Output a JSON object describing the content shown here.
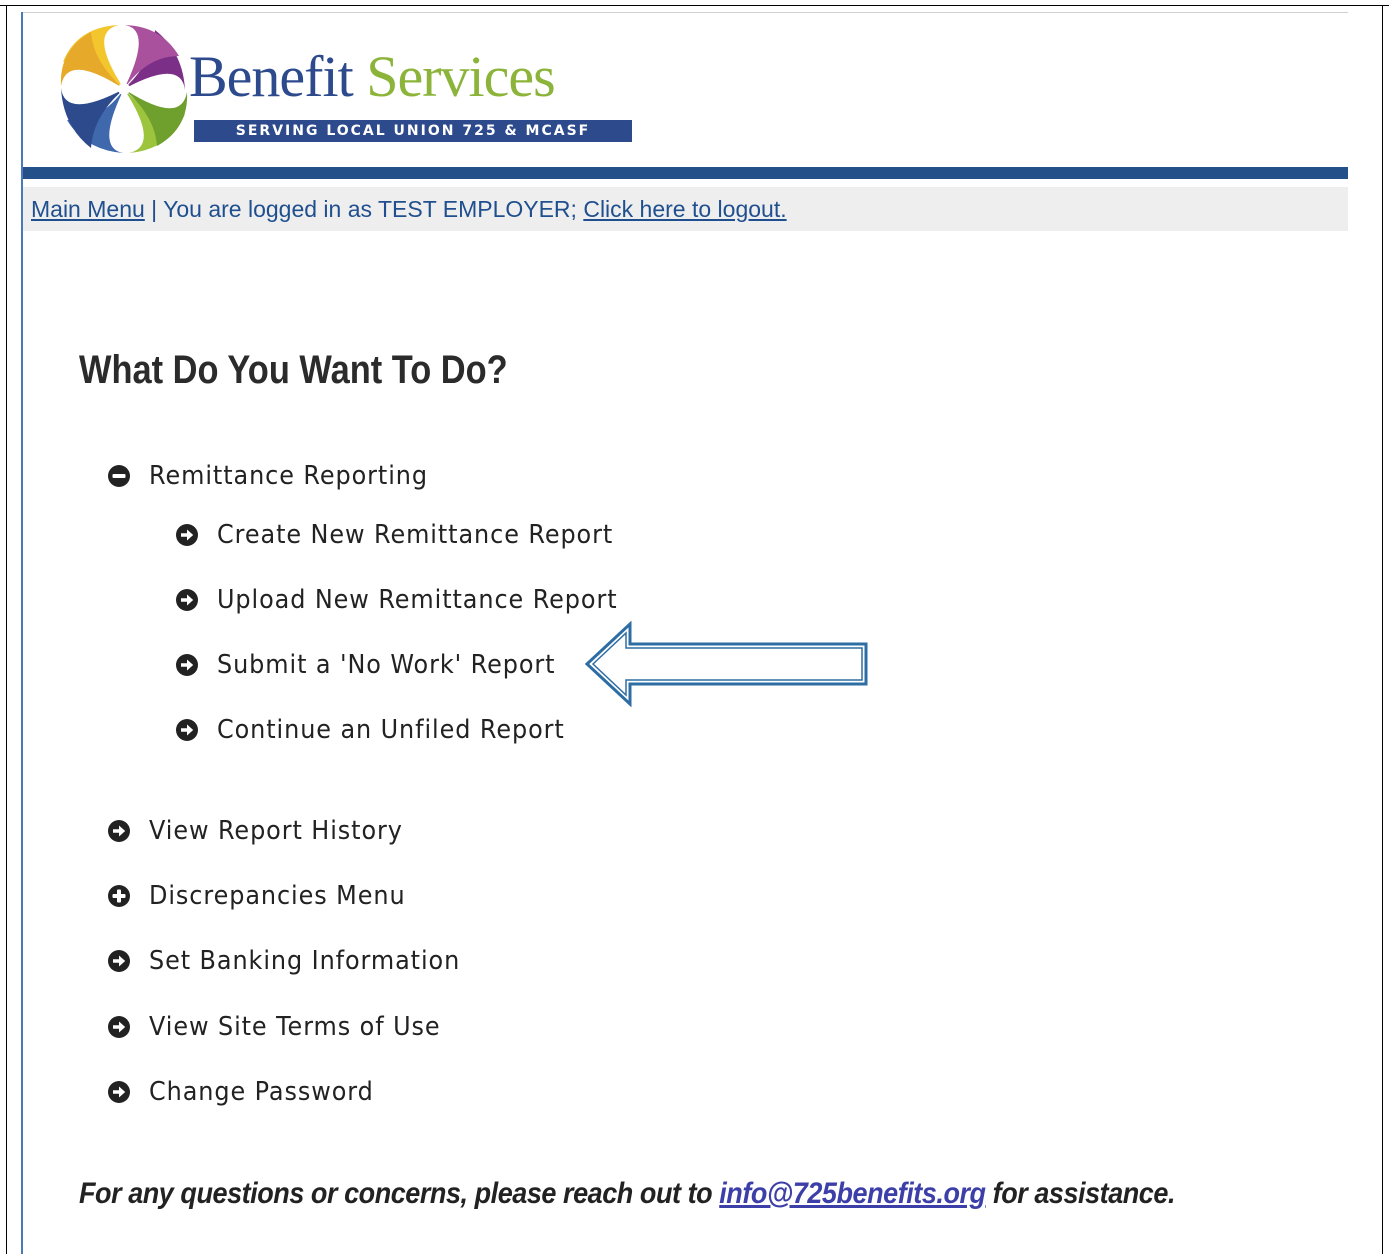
{
  "header": {
    "logo_word1": "Benefit",
    "logo_word2": "Services",
    "tagline": "SERVING LOCAL UNION 725 & MCASF",
    "colors": {
      "brand_blue": "#2c4a8c",
      "brand_green": "#8cb43a",
      "bar_blue": "#245089"
    }
  },
  "nav": {
    "main_menu_link": "Main Menu",
    "separator": " | ",
    "logged_in_text": "You are logged in as TEST EMPLOYER; ",
    "logout_link": "Click here to logout."
  },
  "main": {
    "title": "What Do You Want To Do?",
    "menu": [
      {
        "label": "Remittance Reporting",
        "icon": "minus-circle-icon",
        "expanded": true
      },
      {
        "label": "Create New Remittance Report",
        "icon": "arrow-circle-right-icon"
      },
      {
        "label": "Upload New Remittance Report",
        "icon": "arrow-circle-right-icon"
      },
      {
        "label": "Submit a 'No Work' Report",
        "icon": "arrow-circle-right-icon",
        "highlighted": true
      },
      {
        "label": "Continue an Unfiled Report",
        "icon": "arrow-circle-right-icon"
      },
      {
        "label": "View Report History",
        "icon": "arrow-circle-right-icon"
      },
      {
        "label": "Discrepancies Menu",
        "icon": "plus-circle-icon",
        "expanded": false
      },
      {
        "label": "Set Banking Information",
        "icon": "arrow-circle-right-icon"
      },
      {
        "label": "View Site Terms of Use",
        "icon": "arrow-circle-right-icon"
      },
      {
        "label": "Change Password",
        "icon": "arrow-circle-right-icon"
      }
    ],
    "callout_color": "#2e6da4"
  },
  "footer": {
    "text_before": "For any questions or concerns, please reach out to ",
    "email_link": "info@725benefits.org",
    "text_after": " for assistance."
  }
}
